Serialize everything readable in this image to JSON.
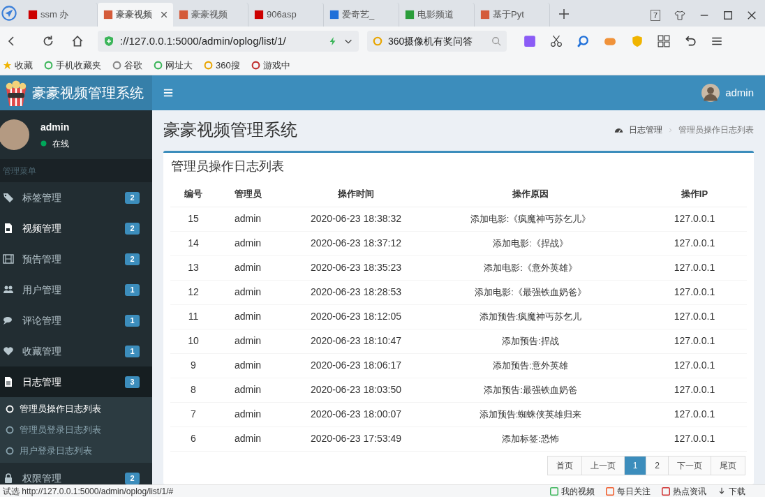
{
  "browser": {
    "tabs": [
      {
        "label": "ssm 办",
        "selected": false
      },
      {
        "label": "豪豪视频",
        "selected": true
      },
      {
        "label": "豪豪视频",
        "selected": false
      },
      {
        "label": "906asp",
        "selected": false
      },
      {
        "label": "爱奇艺_",
        "selected": false
      },
      {
        "label": "电影频道",
        "selected": false
      },
      {
        "label": "基于Pyt",
        "selected": false
      }
    ],
    "tab_count": "7",
    "address": "://127.0.0.1:5000/admin/oplog/list/1/",
    "search_placeholder": "360摄像机有奖问答",
    "bookmarks": [
      "收藏",
      "手机收藏夹",
      "谷歌",
      "网址大",
      "360搜",
      "游戏中"
    ],
    "status_url": "试选  http://127.0.0.1:5000/admin/oplog/list/1/#",
    "status_items": [
      "我的视频",
      "每日关注",
      "热点资讯",
      "下载"
    ]
  },
  "app": {
    "logo_title": "豪豪视频管理系统",
    "header_user": "admin",
    "sidebar": {
      "user_name": "admin",
      "user_status": "在线",
      "menu_heading": "管理菜单",
      "items": [
        {
          "label": "标签管理",
          "count": "2",
          "highlighted": false,
          "expanded": false
        },
        {
          "label": "视频管理",
          "count": "2",
          "highlighted": true,
          "expanded": false
        },
        {
          "label": "预告管理",
          "count": "2",
          "highlighted": false,
          "expanded": false
        },
        {
          "label": "用户管理",
          "count": "1",
          "highlighted": false,
          "expanded": false
        },
        {
          "label": "评论管理",
          "count": "1",
          "highlighted": false,
          "expanded": false
        },
        {
          "label": "收藏管理",
          "count": "1",
          "highlighted": false,
          "expanded": false
        },
        {
          "label": "日志管理",
          "count": "3",
          "highlighted": true,
          "expanded": true,
          "children": [
            {
              "label": "管理员操作日志列表",
              "selected": true
            },
            {
              "label": "管理员登录日志列表",
              "selected": false
            },
            {
              "label": "用户登录日志列表",
              "selected": false
            }
          ]
        },
        {
          "label": "权限管理",
          "count": "2",
          "highlighted": false,
          "expanded": false
        }
      ]
    },
    "page_title": "豪豪视频管理系统",
    "breadcrumb": [
      "日志管理",
      "管理员操作日志列表"
    ],
    "box_title": "管理员操作日志列表",
    "table": {
      "columns": [
        "编号",
        "管理员",
        "操作时间",
        "操作原因",
        "操作IP"
      ],
      "rows": [
        [
          "15",
          "admin",
          "2020-06-23 18:38:32",
          "添加电影:《疯魔神丐苏乞儿》",
          "127.0.0.1"
        ],
        [
          "14",
          "admin",
          "2020-06-23 18:37:12",
          "添加电影:《捍战》",
          "127.0.0.1"
        ],
        [
          "13",
          "admin",
          "2020-06-23 18:35:23",
          "添加电影:《意外英雄》",
          "127.0.0.1"
        ],
        [
          "12",
          "admin",
          "2020-06-23 18:28:53",
          "添加电影:《最强铁血奶爸》",
          "127.0.0.1"
        ],
        [
          "11",
          "admin",
          "2020-06-23 18:12:05",
          "添加预告:疯魔神丐苏乞儿",
          "127.0.0.1"
        ],
        [
          "10",
          "admin",
          "2020-06-23 18:10:47",
          "添加预告:捍战",
          "127.0.0.1"
        ],
        [
          "9",
          "admin",
          "2020-06-23 18:06:17",
          "添加预告:意外英雄",
          "127.0.0.1"
        ],
        [
          "8",
          "admin",
          "2020-06-23 18:03:50",
          "添加预告:最强铁血奶爸",
          "127.0.0.1"
        ],
        [
          "7",
          "admin",
          "2020-06-23 18:00:07",
          "添加预告:蜘蛛侠英雄归来",
          "127.0.0.1"
        ],
        [
          "6",
          "admin",
          "2020-06-23 17:53:49",
          "添加标签:恐怖",
          "127.0.0.1"
        ]
      ]
    },
    "pagination": [
      {
        "label": "首页",
        "selected": false
      },
      {
        "label": "上一页",
        "selected": false
      },
      {
        "label": "1",
        "selected": true
      },
      {
        "label": "2",
        "selected": false
      },
      {
        "label": "下一页",
        "selected": false
      },
      {
        "label": "尾页",
        "selected": false
      }
    ]
  }
}
